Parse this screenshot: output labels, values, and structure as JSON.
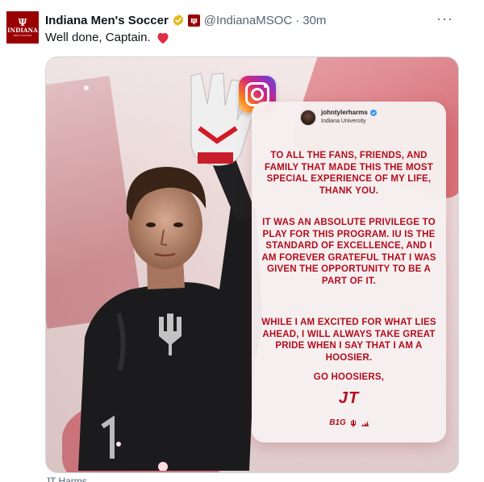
{
  "account": {
    "avatar_glyph": "Ψ",
    "avatar_word": "INDIANA",
    "avatar_sub": "MEN'S SOCCER",
    "name": "Indiana Men's Soccer",
    "handle": "@IndianaMSOC",
    "separator": "·",
    "time": "30m"
  },
  "menu": {
    "more_label": "···"
  },
  "tweet": {
    "text": "Well done, Captain.",
    "emoji": "red-heart-icon"
  },
  "media": {
    "card": {
      "username": "johntylerharms",
      "subtitle": "Indiana University",
      "paragraphs": [
        "TO ALL THE FANS, FRIENDS, AND FAMILY THAT MADE THIS THE MOST SPECIAL EXPERIENCE OF MY LIFE, THANK YOU.",
        "IT WAS AN ABSOLUTE PRIVILEGE TO PLAY FOR THIS PROGRAM. IU IS THE STANDARD OF EXCELLENCE, AND I AM FOREVER GRATEFUL THAT I WAS GIVEN THE OPPORTUNITY TO BE A PART OF IT.",
        "WHILE I AM EXCITED FOR WHAT LIES AHEAD, I WILL ALWAYS TAKE GREAT PRIDE WHEN I SAY THAT I AM A HOOSIER.",
        "GO HOOSIERS,"
      ],
      "signature": "JT",
      "footer_logo": "B1G"
    },
    "icon": "instagram-icon"
  },
  "caption": {
    "text": "JT Harms"
  },
  "colors": {
    "iu_crimson": "#990000",
    "card_text": "#b30d1d",
    "verified_gold": "#e2b719"
  }
}
